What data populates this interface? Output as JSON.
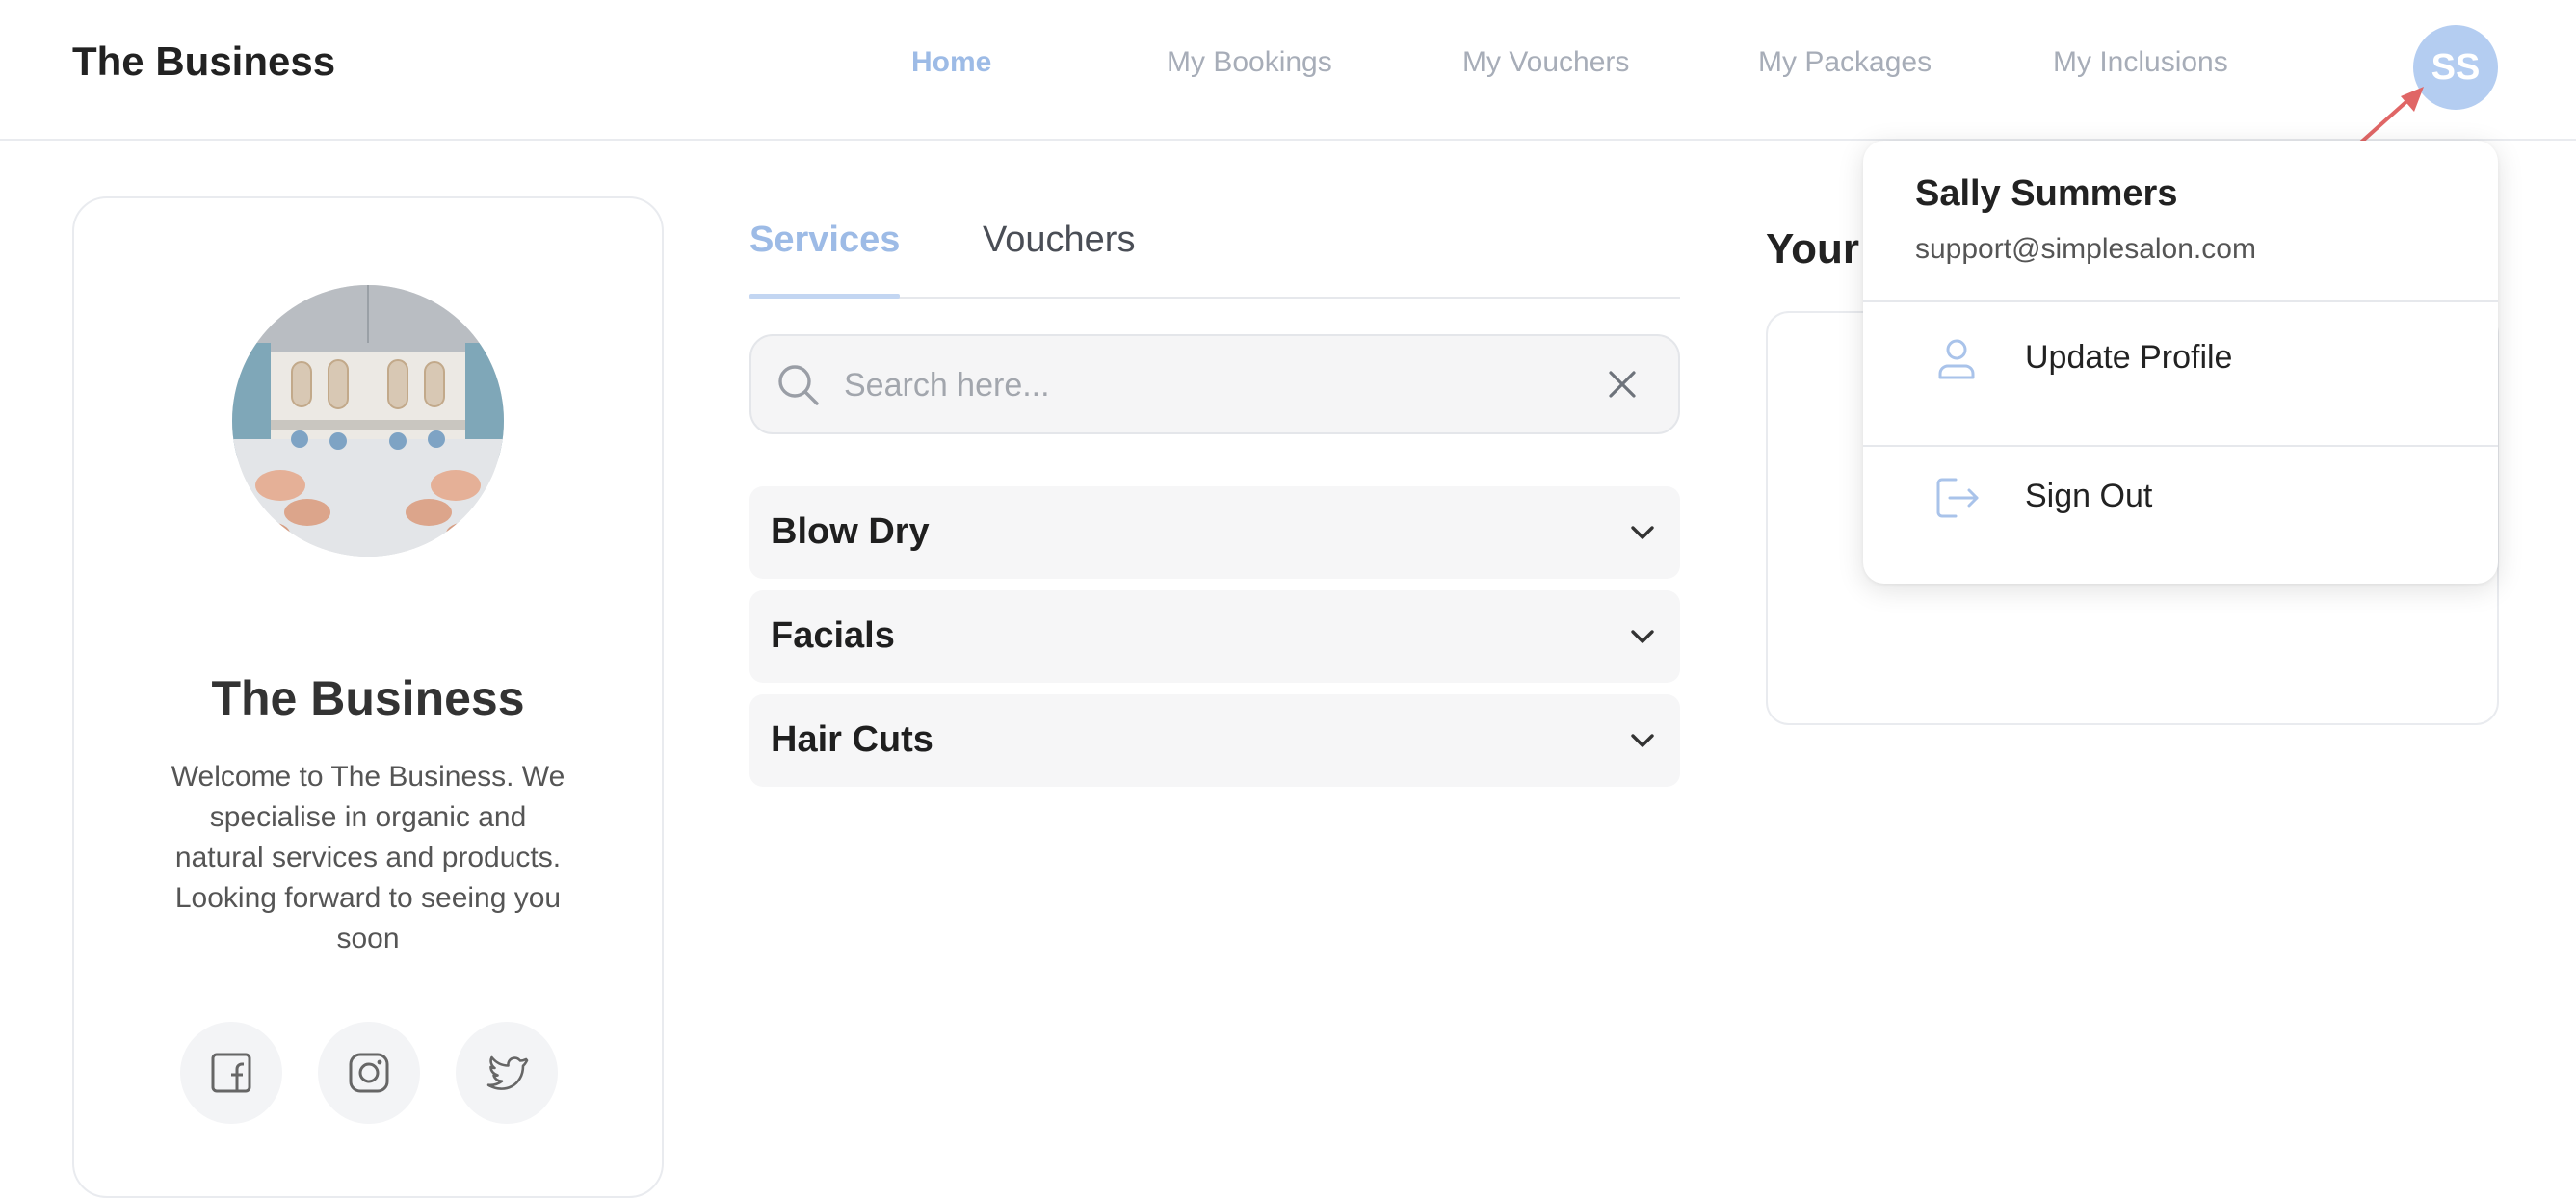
{
  "header": {
    "brand": "The Business",
    "nav": [
      {
        "label": "Home",
        "active": true
      },
      {
        "label": "My Bookings",
        "active": false
      },
      {
        "label": "My Vouchers",
        "active": false
      },
      {
        "label": "My Packages",
        "active": false
      },
      {
        "label": "My Inclusions",
        "active": false
      }
    ],
    "avatar_initials": "SS"
  },
  "profile": {
    "name": "The Business",
    "description": "Welcome to The Business. We specialise in organic and natural services and products. Looking forward to seeing you soon",
    "social": [
      "facebook-icon",
      "instagram-icon",
      "twitter-icon"
    ]
  },
  "tabs": [
    {
      "label": "Services",
      "active": true
    },
    {
      "label": "Vouchers",
      "active": false
    }
  ],
  "search": {
    "placeholder": "Search here...",
    "value": ""
  },
  "categories": [
    "Blow Dry",
    "Facials",
    "Hair Cuts"
  ],
  "right_panel": {
    "title": "Your"
  },
  "user_menu": {
    "name": "Sally Summers",
    "email": "support@simplesalon.com",
    "items": [
      {
        "label": "Update Profile",
        "icon": "user-icon"
      },
      {
        "label": "Sign Out",
        "icon": "sign-out-icon"
      }
    ]
  },
  "colors": {
    "accent": "#9dbbe6",
    "avatar_bg": "#b4cdf1",
    "annotation_arrow": "#e06666"
  }
}
